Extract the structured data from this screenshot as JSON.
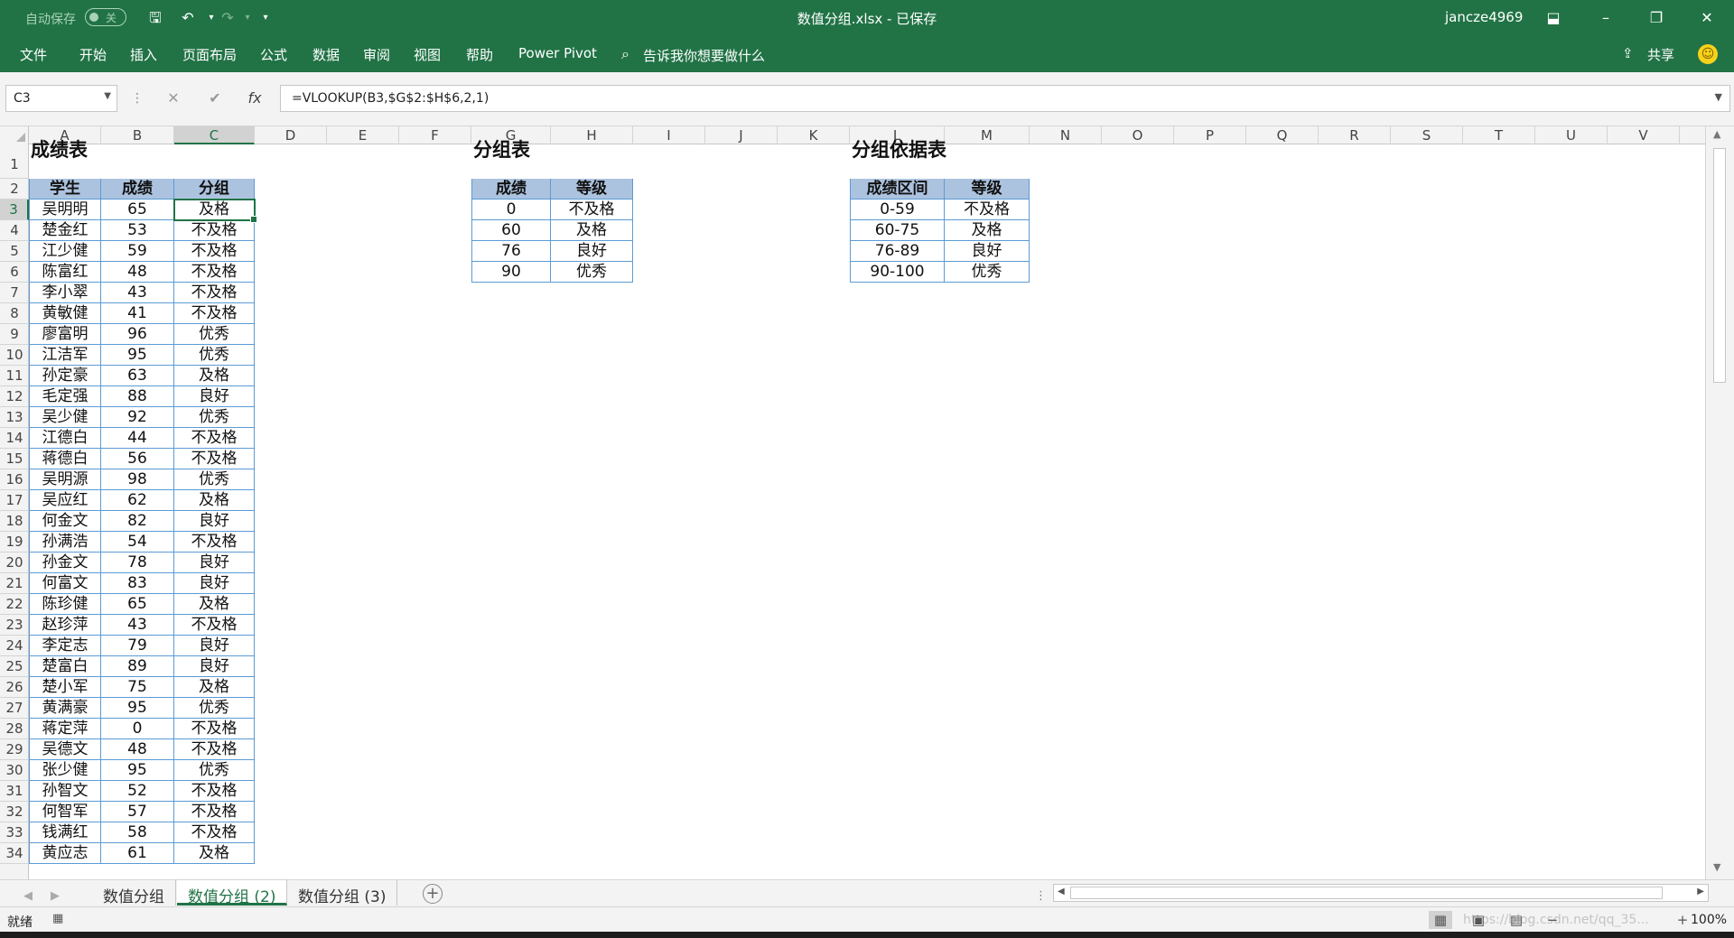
{
  "titlebar": {
    "autosave_label": "自动保存",
    "autosave_state": "关",
    "document_title": "数值分组.xlsx  -  已保存",
    "user": "jancze4969",
    "icons": [
      "save-icon",
      "undo-icon",
      "redo-icon",
      "customize-qat-icon",
      "ribbon-display-icon",
      "minimize-icon",
      "restore-icon",
      "close-icon"
    ]
  },
  "ribbon": {
    "tabs": [
      "文件",
      "开始",
      "插入",
      "页面布局",
      "公式",
      "数据",
      "审阅",
      "视图",
      "帮助",
      "Power Pivot"
    ],
    "tell_me": "告诉我你想要做什么",
    "share": "共享"
  },
  "formula_bar": {
    "name_box": "C3",
    "formula": "=VLOOKUP(B3,$G$2:$H$6,2,1)",
    "fx": "fx"
  },
  "columns": [
    "A",
    "B",
    "C",
    "D",
    "E",
    "F",
    "G",
    "H",
    "I",
    "J",
    "K",
    "L",
    "M",
    "N",
    "O",
    "P",
    "Q",
    "R",
    "S",
    "T",
    "U",
    "V"
  ],
  "rows": [
    "1",
    "2",
    "3",
    "4",
    "5",
    "6",
    "7",
    "8",
    "9",
    "10",
    "11",
    "12",
    "13",
    "14",
    "15",
    "16",
    "17",
    "18",
    "19",
    "20",
    "21",
    "22",
    "23",
    "24",
    "25",
    "26",
    "27",
    "28",
    "29",
    "30",
    "31",
    "32",
    "33",
    "34"
  ],
  "scores_table": {
    "title": "成绩表",
    "headers": [
      "学生",
      "成绩",
      "分组"
    ],
    "rows": [
      [
        "吴明明",
        "65",
        "及格"
      ],
      [
        "楚金红",
        "53",
        "不及格"
      ],
      [
        "江少健",
        "59",
        "不及格"
      ],
      [
        "陈富红",
        "48",
        "不及格"
      ],
      [
        "李小翠",
        "43",
        "不及格"
      ],
      [
        "黄敏健",
        "41",
        "不及格"
      ],
      [
        "廖富明",
        "96",
        "优秀"
      ],
      [
        "江洁军",
        "95",
        "优秀"
      ],
      [
        "孙定豪",
        "63",
        "及格"
      ],
      [
        "毛定强",
        "88",
        "良好"
      ],
      [
        "吴少健",
        "92",
        "优秀"
      ],
      [
        "江德白",
        "44",
        "不及格"
      ],
      [
        "蒋德白",
        "56",
        "不及格"
      ],
      [
        "吴明源",
        "98",
        "优秀"
      ],
      [
        "吴应红",
        "62",
        "及格"
      ],
      [
        "何金文",
        "82",
        "良好"
      ],
      [
        "孙满浩",
        "54",
        "不及格"
      ],
      [
        "孙金文",
        "78",
        "良好"
      ],
      [
        "何富文",
        "83",
        "良好"
      ],
      [
        "陈珍健",
        "65",
        "及格"
      ],
      [
        "赵珍萍",
        "43",
        "不及格"
      ],
      [
        "李定志",
        "79",
        "良好"
      ],
      [
        "楚富白",
        "89",
        "良好"
      ],
      [
        "楚小军",
        "75",
        "及格"
      ],
      [
        "黄满豪",
        "95",
        "优秀"
      ],
      [
        "蒋定萍",
        "0",
        "不及格"
      ],
      [
        "吴德文",
        "48",
        "不及格"
      ],
      [
        "张少健",
        "95",
        "优秀"
      ],
      [
        "孙智文",
        "52",
        "不及格"
      ],
      [
        "何智军",
        "57",
        "不及格"
      ],
      [
        "钱满红",
        "58",
        "不及格"
      ],
      [
        "黄应志",
        "61",
        "及格"
      ]
    ]
  },
  "group_table": {
    "title": "分组表",
    "headers": [
      "成绩",
      "等级"
    ],
    "rows": [
      [
        "0",
        "不及格"
      ],
      [
        "60",
        "及格"
      ],
      [
        "76",
        "良好"
      ],
      [
        "90",
        "优秀"
      ]
    ]
  },
  "basis_table": {
    "title": "分组依据表",
    "headers": [
      "成绩区间",
      "等级"
    ],
    "rows": [
      [
        "0-59",
        "不及格"
      ],
      [
        "60-75",
        "及格"
      ],
      [
        "76-89",
        "良好"
      ],
      [
        "90-100",
        "优秀"
      ]
    ]
  },
  "sheet_tabs": [
    "数值分组",
    "数值分组 (2)",
    "数值分组 (3)"
  ],
  "active_sheet": "数值分组 (2)",
  "status": {
    "ready": "就绪",
    "watermark": "https://blog.csdn.net/qq_35...",
    "zoom": "100%"
  }
}
